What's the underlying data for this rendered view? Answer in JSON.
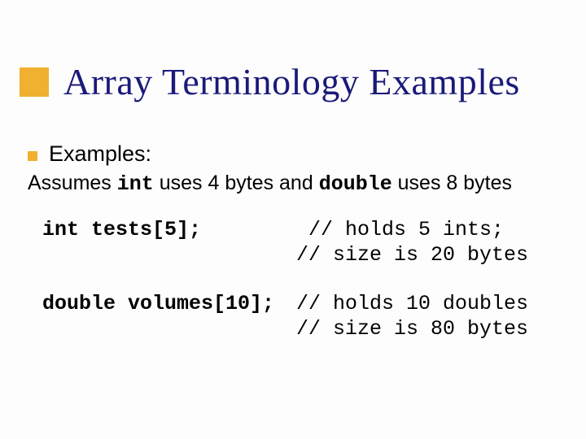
{
  "title": "Array Terminology Examples",
  "bullet": "Examples:",
  "assumes_prefix": "Assumes ",
  "assumes_int": "int",
  "assumes_mid": " uses 4 bytes and ",
  "assumes_double": "double",
  "assumes_suffix": " uses 8 bytes",
  "examples": [
    {
      "decl": "int tests[5];",
      "comment1": " // holds 5 ints;",
      "comment2": "// size is 20 bytes"
    },
    {
      "decl": "double volumes[10];",
      "comment1": "// holds 10 doubles",
      "comment2": "// size is 80 bytes"
    }
  ]
}
